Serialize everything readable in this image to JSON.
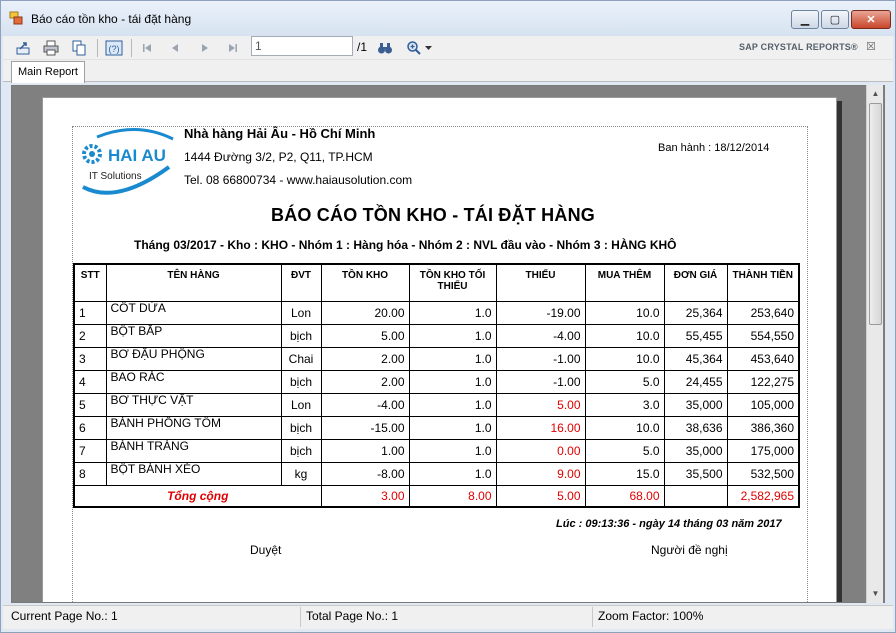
{
  "window": {
    "title": "Báo cáo tồn kho - tái đặt hàng"
  },
  "toolbar": {
    "page_value": "1",
    "page_total": "/1",
    "brand": "SAP CRYSTAL REPORTS®",
    "icons": [
      "export-icon",
      "print-icon",
      "copy-icon",
      "help-icon",
      "first-page-icon",
      "prev-page-icon",
      "next-page-icon",
      "last-page-icon",
      "binoculars-icon",
      "zoom-icon"
    ]
  },
  "tabs": [
    {
      "label": "Main Report"
    }
  ],
  "report": {
    "restaurant_name": "Nhà hàng Hải Âu - Hồ Chí Minh",
    "address": "1444 Đường 3/2, P2, Q11, TP.HCM",
    "contact": "Tel. 08 66800734 - www.haiausolution.com",
    "issued": "Ban hành : 18/12/2014",
    "logo_title": "HAI AU",
    "logo_subtitle": "IT Solutions",
    "title": "BÁO CÁO TỒN KHO - TÁI ĐẶT HÀNG",
    "subtitle": "Tháng 03/2017 - Kho : KHO - Nhóm 1 : Hàng hóa - Nhóm 2 : NVL đầu vào - Nhóm 3 : HÀNG KHÔ",
    "columns": [
      "STT",
      "TÊN HÀNG",
      "ĐVT",
      "TỒN KHO",
      "TỒN KHO TỐI THIỂU",
      "THIẾU",
      "MUA THÊM",
      "ĐƠN GIÁ",
      "THÀNH TIỀN"
    ],
    "rows": [
      {
        "stt": "1",
        "name": "CÔT DỪA",
        "unit": "Lon",
        "stock": "20.00",
        "min": "1.0",
        "short": "-19.00",
        "buy": "10.0",
        "price": "25,364",
        "total": "253,640",
        "red": false
      },
      {
        "stt": "2",
        "name": "BỘT BẮP",
        "unit": "bịch",
        "stock": "5.00",
        "min": "1.0",
        "short": "-4.00",
        "buy": "10.0",
        "price": "55,455",
        "total": "554,550",
        "red": false
      },
      {
        "stt": "3",
        "name": "BƠ ĐẬU PHỘNG",
        "unit": "Chai",
        "stock": "2.00",
        "min": "1.0",
        "short": "-1.00",
        "buy": "10.0",
        "price": "45,364",
        "total": "453,640",
        "red": false
      },
      {
        "stt": "4",
        "name": "BAO RÁC",
        "unit": "bịch",
        "stock": "2.00",
        "min": "1.0",
        "short": "-1.00",
        "buy": "5.0",
        "price": "24,455",
        "total": "122,275",
        "red": false
      },
      {
        "stt": "5",
        "name": "BƠ THỰC VẬT",
        "unit": "Lon",
        "stock": "-4.00",
        "min": "1.0",
        "short": "5.00",
        "buy": "3.0",
        "price": "35,000",
        "total": "105,000",
        "red": true
      },
      {
        "stt": "6",
        "name": "BÁNH PHỒNG TÔM",
        "unit": "bịch",
        "stock": "-15.00",
        "min": "1.0",
        "short": "16.00",
        "buy": "10.0",
        "price": "38,636",
        "total": "386,360",
        "red": true
      },
      {
        "stt": "7",
        "name": "BÁNH TRÁNG",
        "unit": "bịch",
        "stock": "1.00",
        "min": "1.0",
        "short": "0.00",
        "buy": "5.0",
        "price": "35,000",
        "total": "175,000",
        "red": true
      },
      {
        "stt": "8",
        "name": "BỘT BÁNH XÈO",
        "unit": "kg",
        "stock": "-8.00",
        "min": "1.0",
        "short": "9.00",
        "buy": "15.0",
        "price": "35,500",
        "total": "532,500",
        "red": true
      }
    ],
    "total_row": {
      "label": "Tổng cộng",
      "stock": "3.00",
      "min": "8.00",
      "short": "5.00",
      "buy": "68.00",
      "total": "2,582,965"
    },
    "timestamp": "Lúc : 09:13:36 - ngày 14 tháng 03 năm 2017",
    "approved": "Duyệt",
    "requester": "Người đề nghị"
  },
  "statusbar": {
    "current_page": "Current Page No.: 1",
    "total_page": "Total Page No.: 1",
    "zoom": "Zoom Factor: 100%"
  },
  "colors": {
    "accent": "#1a8ad0",
    "negative": "#e00000",
    "viewer_bg": "#808080"
  }
}
